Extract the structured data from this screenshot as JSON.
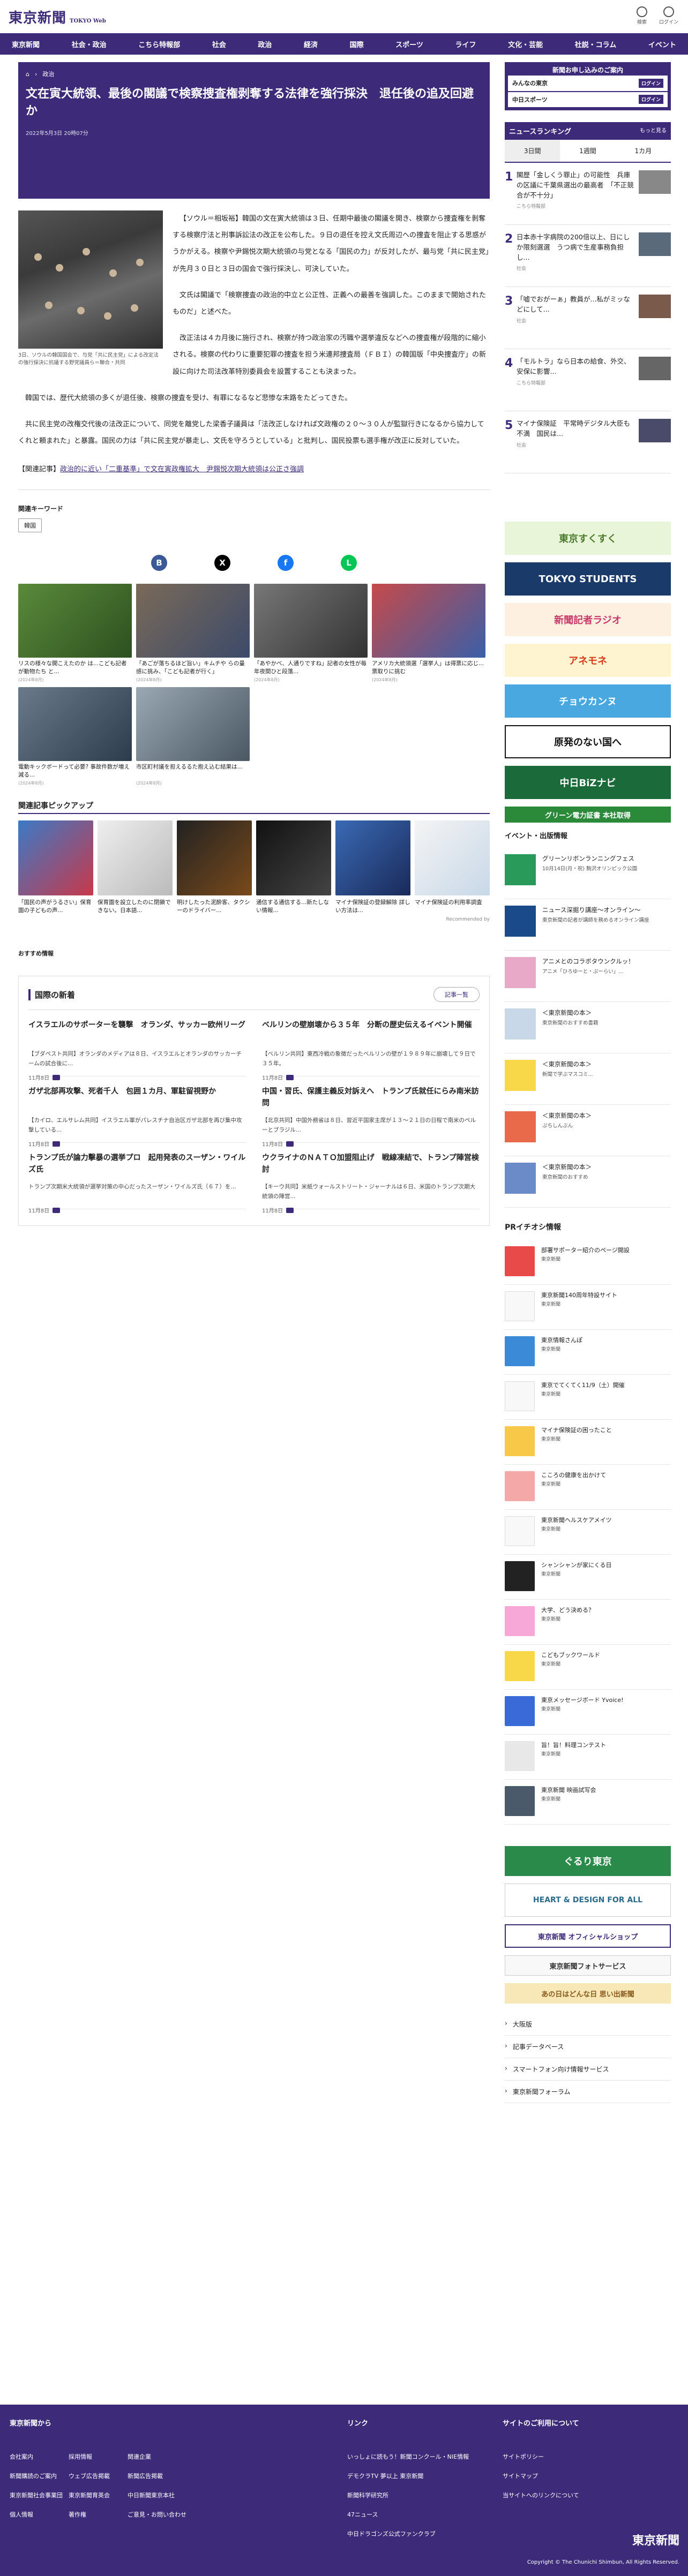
{
  "header": {
    "logo": "東京新聞",
    "logo_sub": "TOKYO Web",
    "search_label": "検索",
    "login_label": "ログイン"
  },
  "nav": [
    "東京新聞",
    "社会・政治",
    "こちら特報部",
    "社会",
    "政治",
    "経済",
    "国際",
    "スポーツ",
    "ライフ",
    "文化・芸能",
    "社説・コラム",
    "イベント"
  ],
  "breadcrumb": [
    "政治"
  ],
  "article": {
    "title": "文在寅大統領、最後の閣議で検察捜査権剥奪する法律を強行採決　退任後の追及回避か",
    "date": "2022年5月3日 20時07分",
    "caption": "3日、ソウルの韓国国会で、与党「共に民主党」による改定法の強行採決に抗議する野党議員ら＝聯合・共同",
    "paragraphs": [
      "【ソウル＝相坂裕】韓国の文在寅大統領は３日、任期中最後の閣議を開き、検察から捜査権を剝奪する検察庁法と刑事訴訟法の改正を公布した。９日の退任を控え文氏周辺への捜査を阻止する思惑がうかがえる。検察や尹錫悦次期大統領の与党となる「国民の力」が反対したが、最与党「共に民主党」が先月３０日と３日の国会で強行採決し、可決していた。",
      "文氏は閣議で「検察捜査の政治的中立と公正性、正義への最善を強調した。このままで開始されたものだ」と述べた。",
      "改正法は４カ月後に施行され、検察が持つ政治家の汚職や選挙違反などへの捜査権が段階的に縮小される。検察の代わりに重要犯罪の捜査を担う米連邦捜査局（ＦＢＩ）の韓国版「中央捜査庁」の新設に向けた司法改革特別委員会を設置することも決まった。",
      "韓国では、歴代大統領の多くが退任後、検察の捜査を受け、有罪になるなど悲惨な末路をたどってきた。",
      "共に民主党の改権交代後の法改正について、同党を離党した梁香子議員は「法改正しなければ文政権の２０～３０人が監獄行きになるから協力してくれと頼まれた」と暴露。国民の力は「共に民主党が暴走し、文氏を守ろうとしている」と批判し、国民投票も選手権が改正に反対していた。"
    ],
    "related_label": "【関連記事】",
    "related_link": "政治的に近い「二重基準」で文在寅政権拡大　尹錫悦次期大統領は公正さ強調"
  },
  "keywords": {
    "heading": "関連キーワード",
    "items": [
      "韓国"
    ]
  },
  "share": {
    "facebook": "f",
    "x": "X",
    "line": "L",
    "hatena": "B"
  },
  "photos": [
    {
      "title": "リスの様々な開こえたのか は...こども記者が動物たち と...",
      "date": "(2024年8月)"
    },
    {
      "title": "「あごが落ちるほど旨い」キムチや らの量感に挑み、「こども記者が行く」",
      "date": "(2024年8月)"
    },
    {
      "title": "「あやかべ、人通りですね」記者の女性が毎年夜間ひと段落...",
      "date": "(2024年8月)"
    },
    {
      "title": "アメリカ大統領選「選挙人」は得票に応じ...票取りに挑む",
      "date": "(2024年8月)"
    },
    {
      "title": "電動キックボードって必要? 事故件数が増え減る...",
      "date": "(2024年8月)"
    },
    {
      "title": "市区町村議を担えるるた抱え込む結果は...",
      "date": "(2024年8月)"
    }
  ],
  "pickup": {
    "heading": "関連記事ピックアップ",
    "items": [
      "「国民の声がうるさい」保育園の子どもの声...",
      "保育園を設立したのに閉鎖できない。日本語...",
      "明けしたった泥酔客、タクシーのドライバー...",
      "通信する通信する...新たしない情報...",
      "マイナ保険証の登録解除 詳しい方法は...",
      "マイナ保険証の利用率調査"
    ],
    "recommended": "Recommended by"
  },
  "osusume": "おすすめ情報",
  "international": {
    "heading": "国際の新着",
    "more": "記事一覧",
    "items": [
      {
        "title": "イスラエルのサポーターを襲撃　オランダ、サッカー欧州リーグ",
        "body": "【ブダペスト共同】オランダのメディアは８日、イスラエルとオランダのサッカーチームの試合後に...",
        "date": "11月8日"
      },
      {
        "title": "ベルリンの壁崩壊から３５年　分断の歴史伝えるイベント開催",
        "body": "【ベルリン共同】東西冷戦の象徴だったベルリンの壁が１９８９年に崩壊して９日で３５年。",
        "date": "11月8日"
      },
      {
        "title": "ガザ北部再攻撃、死者千人　包囲１カ月、軍駐留視野か",
        "body": "【カイロ、エルサレム共同】イスラエル軍がパレスチナ自治区ガザ北部を再び集中攻撃している...",
        "date": "11月8日"
      },
      {
        "title": "中国・習氏、保護主義反対訴えへ　トランプ氏就任にらみ南米訪問",
        "body": "【北京共同】中国外務省は８日、習近平国家主席が１３～２１日の日程で南米のペルーとブラジル...",
        "date": "11月8日"
      },
      {
        "title": "トランプ氏が論力擊暴の選挙プロ　起用発表のスーザン・ワイルズ氏",
        "body": "トランプ次期米大統領が選挙対策の中心だったスーザン・ワイルズ氏（６７）を...",
        "date": "11月8日"
      },
      {
        "title": "ウクライナのＮＡＴＯ加盟阻止げ　戦線凍結で、トランプ陣営検討",
        "body": "【キーウ共同】米紙ウォールストリート・ジャーナルは６日、米国のトランプ次期大統領の陣営...",
        "date": "11月8日"
      }
    ]
  },
  "sidebar": {
    "subscribe": {
      "title": "新聞お申し込みのご案内",
      "rows": [
        {
          "name": "みんなの東京",
          "tag": "ログイン"
        },
        {
          "name": "中日スポーツ",
          "tag": "ログイン"
        }
      ]
    },
    "ranking": {
      "heading": "ニュースランキング",
      "more": "もっと見る",
      "tabs": [
        "3日間",
        "1週間",
        "1カ月"
      ],
      "items": [
        {
          "title": "閣歴「金しくう罪止」の可能性　兵庫の区議に千葉県選出の最高者　「不正競合が不十分」",
          "src": "こちら特報部"
        },
        {
          "title": "日本赤十字病院の200倍以上、日にしか限刻選選　うつ病で生産事務負担し...",
          "src": "社会"
        },
        {
          "title": "「嘘でおがーぁ」教員が...私がミッなどにして...",
          "src": "社会"
        },
        {
          "title": "「モルトラ」なら日本の給食、外交、安保に影響...",
          "src": "こちら特報部"
        },
        {
          "title": "マイナ保険証　平常時デジタル大臣も不満　国民は...",
          "src": "社会"
        }
      ]
    },
    "banners": [
      "東京すくすく",
      "TOKYO STUDENTS",
      "新聞記者ラジオ",
      "アネモネ",
      "チョウカンヌ",
      "原発のない国へ",
      "中日BiZナビ",
      "グリーン電力証書 本社取得"
    ],
    "events_heading": "イベント・出版情報",
    "events": [
      {
        "title": "グリーンリボンランニングフェス",
        "sub": "10月14日(月・祝) 駒沢オリンピック公園"
      },
      {
        "title": "ニュース深掘り講座〜オンライン〜",
        "sub": "東京新聞の記者が講師を務めるオンライン講座"
      },
      {
        "title": "アニメとのコラボタウンクルッ！",
        "sub": "アニメ「ひろゆーと・ぷーらい」..."
      },
      {
        "title": "＜東京新聞の本＞",
        "sub": "東京新聞のおすすめ書籍"
      },
      {
        "title": "＜東京新聞の本＞",
        "sub": "新聞で学ぶマスコミ..."
      },
      {
        "title": "＜東京新聞の本＞",
        "sub": "ぷちしんぶん"
      },
      {
        "title": "＜東京新聞の本＞",
        "sub": "東京新聞のおすすめ"
      }
    ],
    "pr_heading": "PRイチオシ情報",
    "pr": [
      {
        "title": "部署サポーター紹介のページ開設",
        "sub": "東京新聞"
      },
      {
        "title": "東京新聞140周年特設サイト",
        "sub": "東京新聞"
      },
      {
        "title": "東京情報さんぽ",
        "sub": "東京新聞"
      },
      {
        "title": "東京でてくてく11/9（土）開催",
        "sub": "東京新聞"
      },
      {
        "title": "マイナ保険証の困ったこと",
        "sub": "東京新聞"
      },
      {
        "title": "こころの健康を出かけて",
        "sub": "東京新聞"
      },
      {
        "title": "東京新聞ヘルスケアメイツ",
        "sub": "東京新聞"
      },
      {
        "title": "シャンシャンが家にくる日",
        "sub": "東京新聞"
      },
      {
        "title": "大学、どう決める？",
        "sub": "東京新聞"
      },
      {
        "title": "こどもブックワールド",
        "sub": "東京新聞"
      },
      {
        "title": "東京メッセージボード Yvoice!",
        "sub": "東京新聞"
      },
      {
        "title": "旨！旨！料理コンテスト",
        "sub": "東京新聞"
      },
      {
        "title": "東京新聞 映画試写会",
        "sub": "東京新聞"
      }
    ],
    "banners2": [
      "ぐるり東京",
      "HEART & DESIGN FOR ALL",
      "東京新聞 オフィシャルショップ",
      "東京新聞フォトサービス",
      "あの日はどんな日 思い出新聞"
    ],
    "links": [
      "大阪版",
      "記事データベース",
      "スマートフォン向け情報サービス",
      "東京新聞フォーラム"
    ]
  },
  "footer": {
    "col1_title": "東京新聞から",
    "col1": [
      "会社案内",
      "採用情報",
      "関連企業",
      "新聞購読のご案内",
      "ウェブ広告掲載",
      "新聞広告掲載",
      "東京新聞社会事業団",
      "東京新聞育英会",
      "中日新聞東京本社",
      "個人情報",
      "著作権",
      "ご意見・お問い合わせ"
    ],
    "col2_title": "リンク",
    "col2": [
      "いっしょに読もう！新聞コンクール・NIE情報",
      "デモクラTV 夢以上 東京新聞",
      "新聞科学研究所",
      "47ニュース",
      "中日ドラゴンズ公式ファンクラブ"
    ],
    "col3_title": "サイトのご利用について",
    "col3": [
      "サイトポリシー",
      "サイトマップ",
      "当サイトへのリンクについて"
    ],
    "logo": "東京新聞",
    "copyright": "Copyright © The Chunichi Shimbun, All Rights Reserved."
  }
}
